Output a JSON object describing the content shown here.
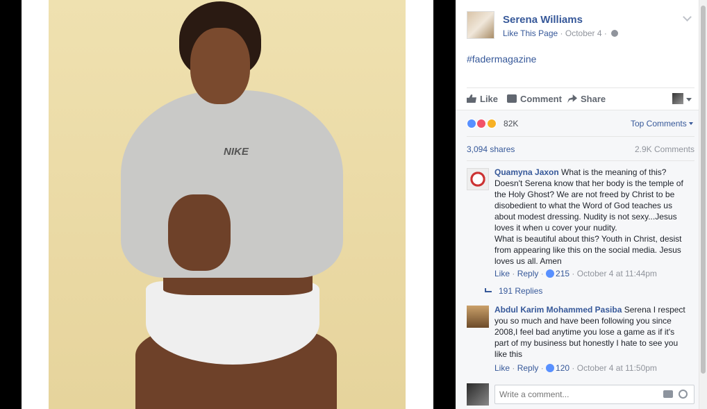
{
  "post": {
    "page_name": "Serena Williams",
    "like_page": "Like This Page",
    "date": "October 4",
    "text": "#fadermagazine",
    "photo_brand_text": "NIKE"
  },
  "actions": {
    "like": "Like",
    "comment": "Comment",
    "share": "Share"
  },
  "feedback": {
    "reaction_count": "82K",
    "top_comments": "Top Comments",
    "shares": "3,094 shares",
    "comments_count": "2.9K Comments",
    "reaction_icons": [
      "like-icon",
      "love-icon",
      "wow-icon"
    ]
  },
  "comments": [
    {
      "author": "Quamyna Jaxon",
      "text": "What is the meaning of this? Doesn't Serena know that her body is the temple of the Holy Ghost? We are not freed by Christ to be disobedient to what the Word of God teaches us about modest dressing. Nudity is not sexy...Jesus loves it when u cover your nudity.",
      "text2": "What is beautiful about this? Youth in Christ, desist from appearing like this on the social media. Jesus loves us all. Amen",
      "like": "Like",
      "reply": "Reply",
      "likes": "215",
      "time": "October 4 at 11:44pm",
      "replies": "191 Replies"
    },
    {
      "author": "Abdul Karim Mohammed Pasiba",
      "text": "Serena I respect you so much and have been following you since 2008,I feel bad anytime you lose a game as if it's part of my business but honestly I hate to see you like this",
      "like": "Like",
      "reply": "Reply",
      "likes": "120",
      "time": "October 4 at 11:50pm"
    }
  ],
  "composer": {
    "placeholder": "Write a comment..."
  }
}
